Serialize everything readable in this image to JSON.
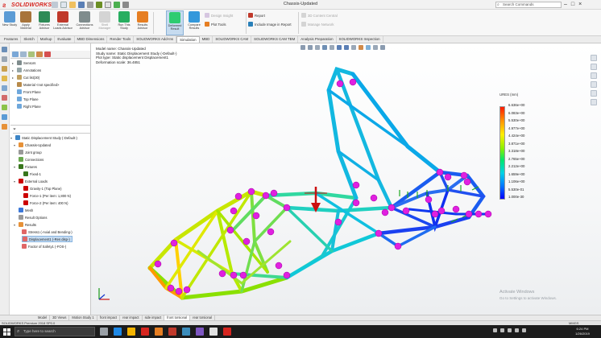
{
  "window": {
    "app_name": "SOLIDWORKS",
    "title": "Chassis-Updated",
    "search_placeholder": "Search Commands",
    "controls": [
      "–",
      "□",
      "×"
    ]
  },
  "ribbon": {
    "buttons": [
      {
        "label": "New Study",
        "icon": "new-study-icon",
        "color": "#5b9bd5"
      },
      {
        "label": "Apply Material",
        "icon": "apply-material-icon",
        "color": "#a8743a"
      },
      {
        "label": "Fixtures Advisor",
        "icon": "fixtures-icon",
        "color": "#2e8b57"
      },
      {
        "label": "External Loads Advisor",
        "icon": "loads-icon",
        "color": "#c0392b"
      },
      {
        "label": "Connections Advisor",
        "icon": "connections-icon",
        "color": "#7f8c8d"
      },
      {
        "label": "Shell Manager",
        "icon": "shell-manager-icon",
        "color": "#b0b0b0"
      },
      {
        "label": "Run This Study",
        "icon": "run-study-icon",
        "color": "#27ae60"
      },
      {
        "label": "Results Advisor",
        "icon": "results-advisor-icon",
        "color": "#e67e22"
      },
      {
        "label": "Deformed Result",
        "icon": "deformed-result-icon",
        "color": "#2ecc71"
      },
      {
        "label": "Compare Results",
        "icon": "compare-results-icon",
        "color": "#3498db"
      }
    ],
    "small_buttons": [
      {
        "label": "Plot Tools",
        "icon": "plot-tools-icon",
        "color": "#e67e22"
      },
      {
        "label": "Design Insight",
        "icon": "design-insight-icon",
        "color": "#9b59b6"
      },
      {
        "label": "Report",
        "icon": "report-icon",
        "color": "#c0392b"
      },
      {
        "label": "Include Image in Report",
        "icon": "include-image-icon",
        "color": "#2980b9"
      },
      {
        "label": "3D Content Central",
        "icon": "3d-content-icon",
        "color": "#b0b0b0"
      },
      {
        "label": "Manage Network",
        "icon": "manage-network-icon",
        "color": "#b0b0b0"
      }
    ]
  },
  "command_tabs": {
    "items": [
      "Features",
      "Sketch",
      "Markup",
      "Evaluate",
      "MBD Dimensions",
      "Render Tools",
      "SOLIDWORKS Add-Ins",
      "Simulation",
      "MBD",
      "SOLIDWORKS CAM",
      "SOLIDWORKS CAM TBM",
      "Analysis Preparation",
      "SOLIDWORKS Inspection"
    ],
    "active": "Simulation"
  },
  "tree": {
    "top_items": [
      {
        "label": "Sensors",
        "icon_color": "#7f8c8d",
        "expander": "▸"
      },
      {
        "label": "Annotations",
        "icon_color": "#95a5a6",
        "expander": "▸"
      },
      {
        "label": "Cut list(30)",
        "icon_color": "#c0a060",
        "expander": "▸"
      },
      {
        "label": "Material <not specified>",
        "icon_color": "#b88a4a",
        "expander": ""
      },
      {
        "label": "Front Plane",
        "icon_color": "#6fa8dc",
        "expander": ""
      },
      {
        "label": "Top Plane",
        "icon_color": "#6fa8dc",
        "expander": ""
      },
      {
        "label": "Right Plane",
        "icon_color": "#6fa8dc",
        "expander": ""
      }
    ],
    "study_items": [
      {
        "label": "Static Displacement Study (-Default-)",
        "icon_color": "#3d85c6",
        "expander": "▾"
      },
      {
        "label": "Chassis-Updated",
        "icon_color": "#e69138",
        "expander": "▾"
      },
      {
        "label": "Joint group",
        "icon_color": "#999999",
        "expander": ""
      },
      {
        "label": "Connections",
        "icon_color": "#6aa84f",
        "expander": ""
      },
      {
        "label": "Fixtures",
        "icon_color": "#38761d",
        "expander": "▾"
      },
      {
        "label": "Fixed-1",
        "icon_color": "#38761d",
        "expander": ""
      },
      {
        "label": "External Loads",
        "icon_color": "#cc0000",
        "expander": "▾"
      },
      {
        "label": "Gravity-1 (Top Plane)",
        "icon_color": "#cc0000",
        "expander": ""
      },
      {
        "label": "Force-1 (Per item: 1,800 N)",
        "icon_color": "#cc0000",
        "expander": ""
      },
      {
        "label": "Force-2 (Per item: 400 N)",
        "icon_color": "#cc0000",
        "expander": ""
      },
      {
        "label": "Mesh",
        "icon_color": "#3c78d8",
        "expander": ""
      },
      {
        "label": "Result Options",
        "icon_color": "#999999",
        "expander": ""
      },
      {
        "label": "Results",
        "icon_color": "#e69138",
        "expander": "▾"
      },
      {
        "label": "Stress1 (-Axial and Bending-)",
        "icon_color": "#e06666",
        "expander": ""
      },
      {
        "label": "Displacement1 (-Res disp-)",
        "icon_color": "#e06666",
        "expander": "",
        "selected": true
      },
      {
        "label": "Factor of Safety1 (-FOS-)",
        "icon_color": "#e06666",
        "expander": ""
      }
    ]
  },
  "viewport": {
    "info_lines": [
      "Model name: Chassis-Updated",
      "Study name: Static Displacement Study (-Default-)",
      "Plot type: Static displacement Displacement1",
      "Deformation scale: 36.4851"
    ],
    "legend_title": "URES (mm)",
    "legend_labels": [
      "6.636e+00",
      "6.083e+00",
      "5.530e+00",
      "4.977e+00",
      "4.424e+00",
      "3.871e+00",
      "3.318e+00",
      "2.765e+00",
      "2.212e+00",
      "1.659e+00",
      "1.106e+00",
      "5.530e-01",
      "1.000e-30"
    ],
    "watermark_line1": "Activate Windows",
    "watermark_line2": "Go to Settings to activate Windows."
  },
  "bottom_tabs": {
    "items": [
      "Model",
      "3D Views",
      "Motion Study 1",
      "front impact",
      "rear impact",
      "side impact",
      "front torsional",
      "rear torsional"
    ],
    "active": "front torsional"
  },
  "status": {
    "left": "SOLIDWORKS Premium 2018 SP0.0",
    "right": "MMGS"
  },
  "taskbar": {
    "search_placeholder": "Type here to search",
    "time": "6:24 PM",
    "date": "1/26/2019",
    "app_colors": [
      "#9aa0a6",
      "#1e88e5",
      "#f4b400",
      "#d6251f",
      "#e67e22",
      "#c0392b",
      "#3c8dbc",
      "#7e57c2",
      "#e0e0e0",
      "#d6251f"
    ]
  }
}
